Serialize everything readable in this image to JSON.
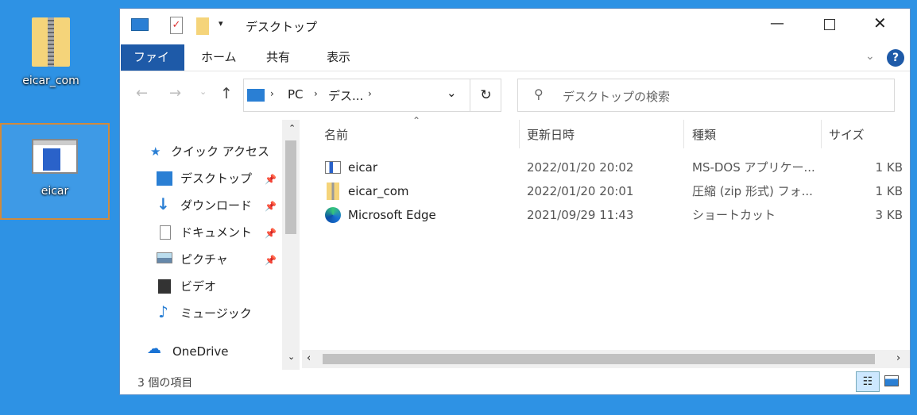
{
  "desktop": {
    "icons": [
      {
        "label": "eicar_com"
      },
      {
        "label": "eicar"
      }
    ]
  },
  "window": {
    "title": "デスクトップ",
    "ribbon": {
      "tabs": [
        "ファイル",
        "ホーム",
        "共有",
        "表示"
      ],
      "help": "?"
    },
    "address": {
      "crumbs": [
        "PC",
        "デス..."
      ],
      "search_placeholder": "デスクトップの検索"
    },
    "nav": {
      "quick_access": "クイック アクセス",
      "items": [
        {
          "label": "デスクトップ",
          "pinned": true
        },
        {
          "label": "ダウンロード",
          "pinned": true
        },
        {
          "label": "ドキュメント",
          "pinned": true
        },
        {
          "label": "ピクチャ",
          "pinned": true
        },
        {
          "label": "ビデオ",
          "pinned": false
        },
        {
          "label": "ミュージック",
          "pinned": false
        }
      ],
      "onedrive": "OneDrive"
    },
    "columns": [
      "名前",
      "更新日時",
      "種類",
      "サイズ"
    ],
    "files": [
      {
        "name": "eicar",
        "date": "2022/01/20 20:02",
        "type": "MS-DOS アプリケー...",
        "size": "1 KB"
      },
      {
        "name": "eicar_com",
        "date": "2022/01/20 20:01",
        "type": "圧縮 (zip 形式) フォ...",
        "size": "1 KB"
      },
      {
        "name": "Microsoft Edge",
        "date": "2021/09/29 11:43",
        "type": "ショートカット",
        "size": "3 KB"
      }
    ],
    "status": "3 個の項目"
  },
  "colors": {
    "accent": "#1e5aa8",
    "desktop": "#2e92e4",
    "selection_border": "#d08a3c"
  }
}
